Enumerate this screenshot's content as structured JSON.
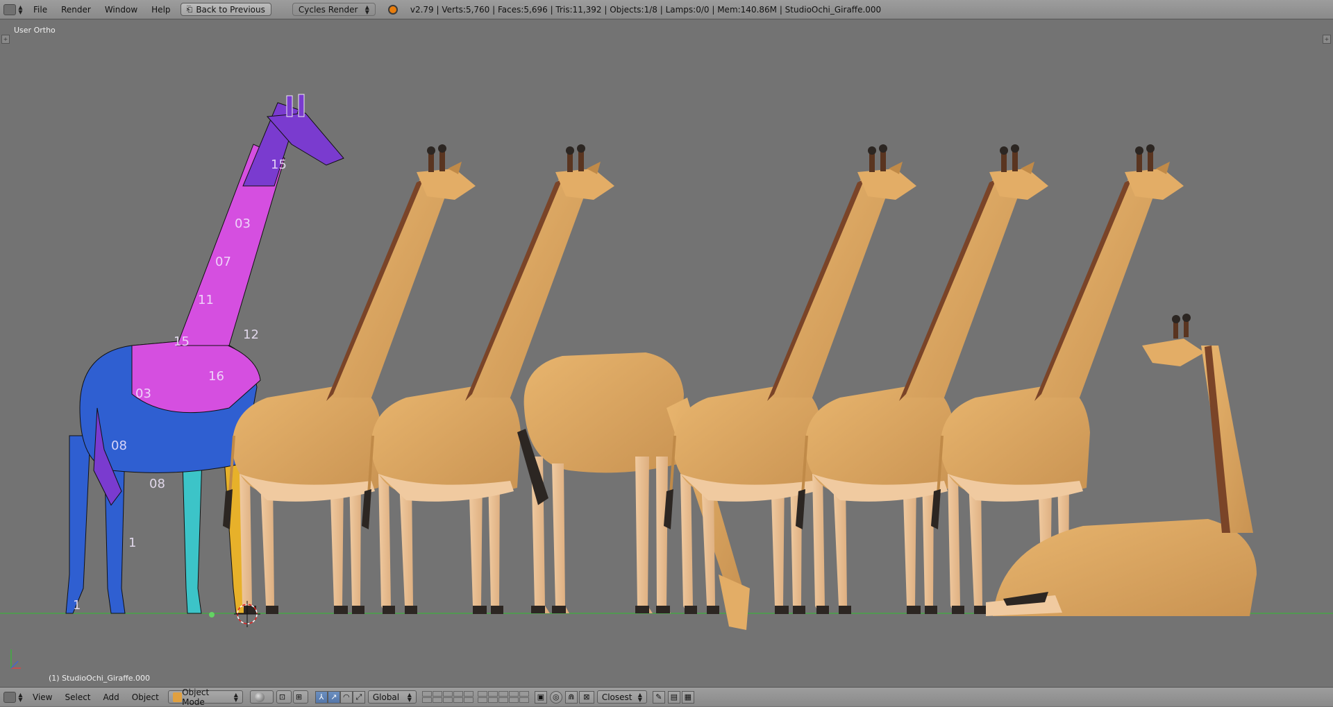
{
  "topbar": {
    "menus": [
      "File",
      "Render",
      "Window",
      "Help"
    ],
    "back_label": "Back to Previous",
    "render_engine": "Cycles Render",
    "stats": "v2.79 | Verts:5,760 | Faces:5,696 | Tris:11,392 | Objects:1/8 | Lamps:0/0 | Mem:140.86M | StudioOchi_Giraffe.000"
  },
  "viewport": {
    "view_label": "User Ortho",
    "object_label": "(1) StudioOchi_Giraffe.000",
    "uv_labels": [
      "15",
      "03",
      "07",
      "11",
      "12",
      "15",
      "16",
      "03",
      "08",
      "08",
      "1",
      "1"
    ]
  },
  "bottombar": {
    "menus": [
      "View",
      "Select",
      "Add",
      "Object"
    ],
    "mode": "Object Mode",
    "orientation": "Global",
    "snap_target": "Closest"
  },
  "colors": {
    "background": "#737373",
    "giraffe_body": "#d9a65f",
    "giraffe_shadow": "#c08a48",
    "giraffe_mane": "#7a4428",
    "hoof": "#2c2622",
    "uv_magenta": "#d54fe0",
    "uv_blue": "#2f5fd1",
    "uv_purple": "#7a3bcf",
    "uv_cyan": "#3cc4c8",
    "uv_yellow": "#e7b12a"
  }
}
